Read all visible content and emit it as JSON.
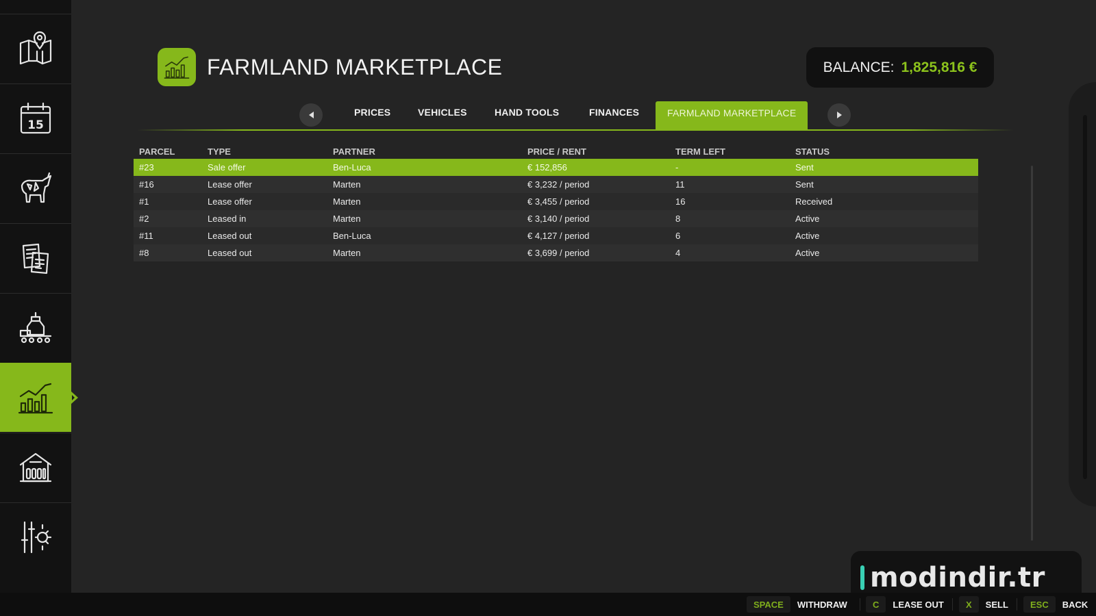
{
  "sidebar": {
    "items": [
      {
        "icon": "map-icon",
        "active": false
      },
      {
        "icon": "calendar-icon",
        "active": false,
        "text": "15"
      },
      {
        "icon": "cow-icon",
        "active": false
      },
      {
        "icon": "contracts-icon",
        "active": false
      },
      {
        "icon": "production-icon",
        "active": false
      },
      {
        "icon": "prices-chart-icon",
        "active": true
      },
      {
        "icon": "barn-icon",
        "active": false
      },
      {
        "icon": "settings-icon",
        "active": false
      }
    ]
  },
  "header": {
    "title": "FARMLAND MARKETPLACE",
    "icon": "prices-chart-icon",
    "balance_label": "BALANCE:",
    "balance_value": "1,825,816 €"
  },
  "tabs": {
    "items": [
      "PRICES",
      "VEHICLES",
      "HAND TOOLS",
      "FINANCES",
      "FARMLAND MARKETPLACE"
    ],
    "active_index": 4
  },
  "table": {
    "columns": [
      "PARCEL",
      "TYPE",
      "PARTNER",
      "PRICE / RENT",
      "TERM LEFT",
      "STATUS"
    ],
    "rows": [
      {
        "parcel": "#23",
        "type": "Sale offer",
        "partner": "Ben-Luca",
        "price": "€ 152,856",
        "term": "-",
        "status": "Sent",
        "selected": true
      },
      {
        "parcel": "#16",
        "type": "Lease offer",
        "partner": "Marten",
        "price": "€ 3,232 / period",
        "term": "11",
        "status": "Sent",
        "selected": false
      },
      {
        "parcel": "#1",
        "type": "Lease offer",
        "partner": "Marten",
        "price": "€ 3,455 / period",
        "term": "16",
        "status": "Received",
        "selected": false
      },
      {
        "parcel": "#2",
        "type": "Leased in",
        "partner": "Marten",
        "price": "€ 3,140 / period",
        "term": "8",
        "status": "Active",
        "selected": false
      },
      {
        "parcel": "#11",
        "type": "Leased out",
        "partner": "Ben-Luca",
        "price": "€ 4,127 / period",
        "term": "6",
        "status": "Active",
        "selected": false
      },
      {
        "parcel": "#8",
        "type": "Leased out",
        "partner": "Marten",
        "price": "€ 3,699 / period",
        "term": "4",
        "status": "Active",
        "selected": false
      }
    ]
  },
  "watermark": "modindir.tr",
  "bottombar": {
    "hints": [
      {
        "key": "SPACE",
        "label": "WITHDRAW"
      },
      {
        "key": "C",
        "label": "LEASE OUT"
      },
      {
        "key": "X",
        "label": "SELL"
      },
      {
        "key": "ESC",
        "label": "BACK"
      }
    ]
  },
  "colors": {
    "accent": "#86b81b",
    "balance_value": "#8cc21c",
    "background": "#242424",
    "sidebar": "#121212"
  }
}
